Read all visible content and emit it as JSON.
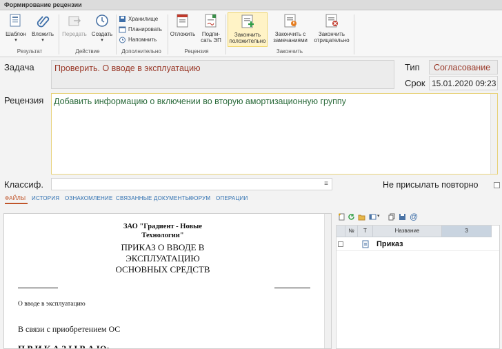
{
  "window": {
    "title": "Формирование рецензии"
  },
  "ribbon": {
    "buttons": {
      "template": "Шаблон",
      "attach": "Вложить",
      "forward": "Передать",
      "create": "Создать",
      "storage": "Хранилище",
      "plan": "Планировать",
      "remind": "Напомнить",
      "postpone": "Отложить",
      "sign_line1": "Подпи-",
      "sign_line2": "сать ЭП",
      "finish_pos_line1": "Закончить",
      "finish_pos_line2": "положительно",
      "finish_rem_line1": "Закончить с",
      "finish_rem_line2": "замечаниями",
      "finish_neg_line1": "Закончить",
      "finish_neg_line2": "отрицательно"
    },
    "groups": {
      "result": "Результат",
      "action": "Действие",
      "extra": "Дополнительно",
      "review": "Рецензия",
      "finish": "Закончить"
    }
  },
  "form": {
    "task_label": "Задача",
    "task_value": "Проверить. О вводе в эксплуатацию",
    "type_label": "Тип",
    "type_value": "Согласование",
    "deadline_label": "Срок",
    "deadline_value": "15.01.2020 09:23",
    "review_label": "Рецензия",
    "review_value": "Добавить информацию о включении во вторую амортизационную группу",
    "classif_label": "Классиф.",
    "classif_value": "",
    "no_repeat_label": "Не присылать повторно"
  },
  "tabs": [
    "ФАЙЛЫ",
    "ИСТОРИЯ",
    "ОЗНАКОМЛЕНИЕ",
    "СВЯЗАННЫЕ ДОКУМЕНТЫ",
    "ФОРУМ",
    "ОПЕРАЦИИ"
  ],
  "document": {
    "org_line1": "ЗАО \"Градиент - Новые",
    "org_line2": "Технологии\"",
    "title_line1": "ПРИКАЗ О ВВОДЕ В",
    "title_line2": "ЭКСПЛУАТАЦИЮ",
    "title_line3": "ОСНОВНЫХ СРЕДСТВ",
    "subject": "О вводе в эксплуатацию",
    "body": "В связи с приобретением ОС",
    "order": "П Р И К А З Ы В А Ю:"
  },
  "files_grid": {
    "headers": {
      "num": "№",
      "type": "T",
      "name": "Название",
      "extra": "З"
    },
    "rows": [
      {
        "name": "Приказ"
      }
    ]
  },
  "colors": {
    "accent": "#c0552a",
    "link": "#2d6fb0",
    "task_text": "#9a3a2a",
    "review_text": "#2a6a3a"
  }
}
